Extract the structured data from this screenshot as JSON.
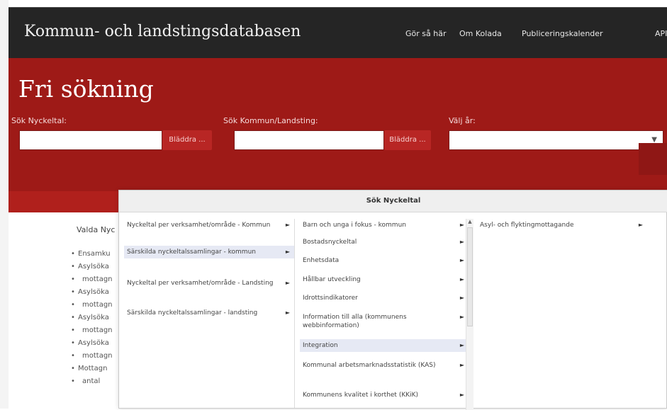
{
  "brand": "Kommun- och landstingsdatabasen",
  "nav": [
    "Gör så här",
    "Om Kolada",
    "Publiceringskalender",
    "API"
  ],
  "page_title": "Fri sökning",
  "search": {
    "nyckeltal_label": "Sök Nyckeltal:",
    "kommun_label": "Sök Kommun/Landsting:",
    "year_label": "Välj år:",
    "browse_label": "Bläddra ..."
  },
  "valda": {
    "title": "Valda Nyc",
    "items": [
      "Ensamku",
      "Asylsöka",
      "mottagn",
      "Asylsöka",
      "mottagn",
      "Asylsöka",
      "mottagn",
      "Asylsöka",
      "mottagn",
      "Mottagn",
      "antal"
    ]
  },
  "popup": {
    "title": "Sök Nyckeltal",
    "col1": [
      {
        "label": "Nyckeltal per verksamhet/område - Kommun",
        "active": false
      },
      {
        "label": "Särskilda nyckeltalssamlingar - kommun",
        "active": true
      },
      {
        "label": "Nyckeltal per verksamhet/område - Landsting",
        "active": false
      },
      {
        "label": "Särskilda nyckeltalssamlingar - landsting",
        "active": false
      }
    ],
    "col2": [
      {
        "label": "Barn och unga i fokus - kommun",
        "active": false
      },
      {
        "label": "Bostadsnyckeltal",
        "active": false
      },
      {
        "label": "Enhetsdata",
        "active": false
      },
      {
        "label": "Hållbar utveckling",
        "active": false
      },
      {
        "label": "Idrottsindikatorer",
        "active": false
      },
      {
        "label": "Information till alla (kommunens webbinformation)",
        "active": false
      },
      {
        "label": "Integration",
        "active": true
      },
      {
        "label": "Kommunal arbetsmarknadsstatistik (KAS)",
        "active": false
      },
      {
        "label": "Kommunens kvalitet i korthet (KKiK)",
        "active": false
      }
    ],
    "col3": [
      {
        "label": "Asyl- och flyktingmottagande",
        "active": false
      }
    ],
    "arrow": "►"
  },
  "icons": {
    "select_arrow": "chevron-down-icon",
    "submenu_arrow": "triangle-right-icon"
  },
  "colors": {
    "nav_bg": "#252525",
    "hero_bg": "#9e1a17",
    "button_bg": "#b82624",
    "active_item": "#e6e9f4"
  }
}
